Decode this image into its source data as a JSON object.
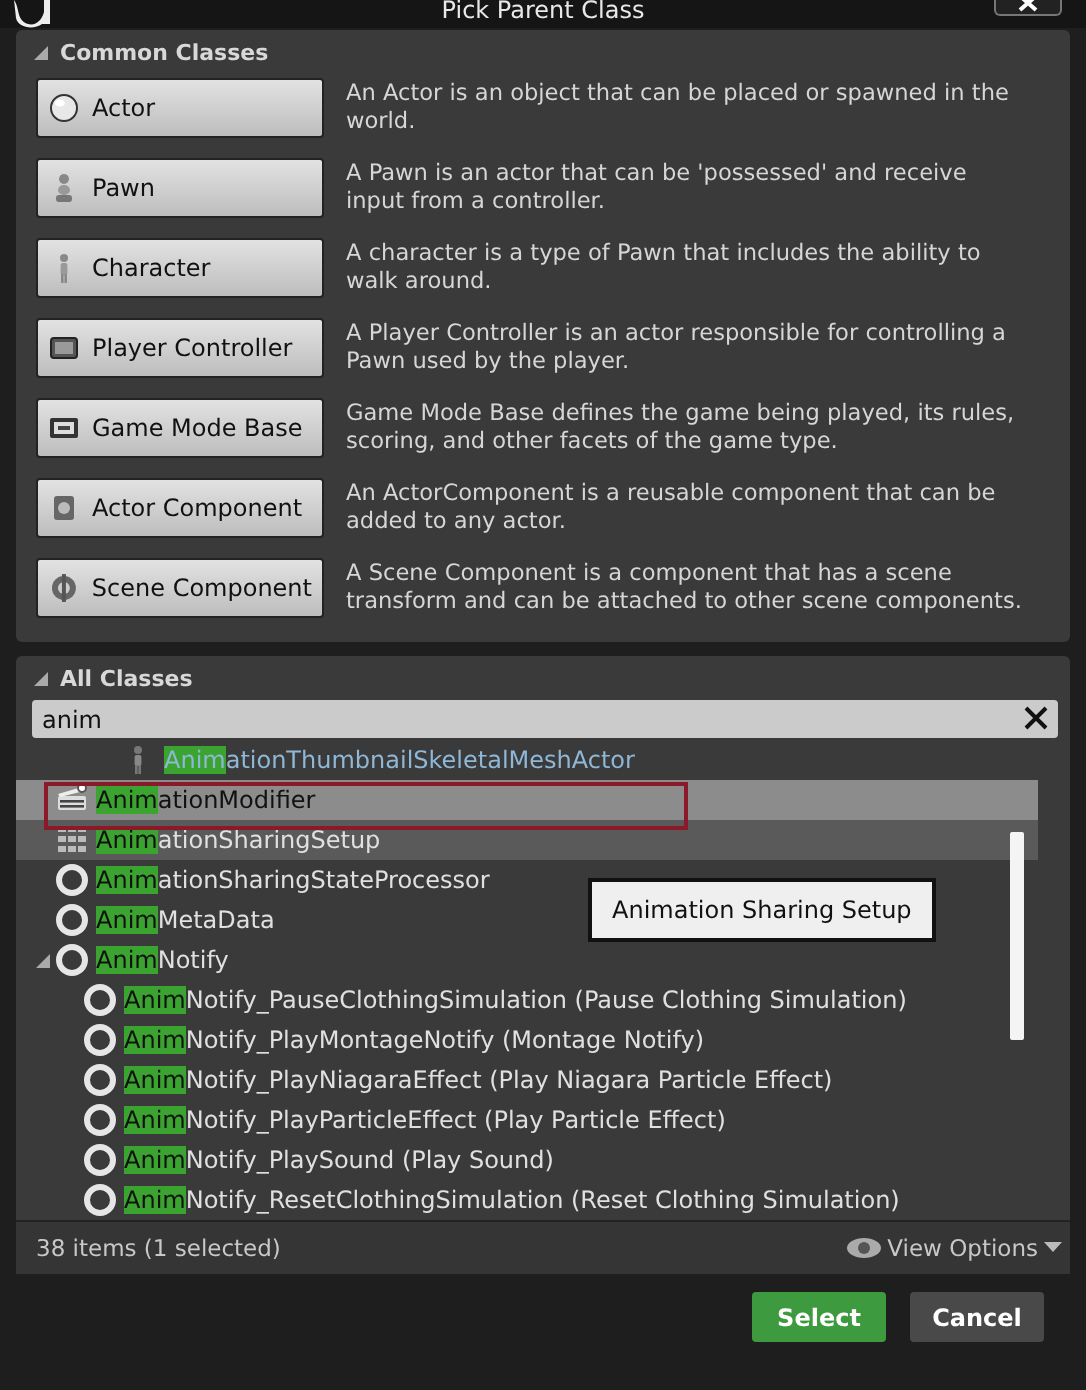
{
  "window": {
    "title": "Pick Parent Class"
  },
  "common_classes": {
    "title": "Common Classes",
    "expanded": true,
    "items": [
      {
        "kind": "actor",
        "label": "Actor",
        "description": "An Actor is an object that can be placed or spawned in the world."
      },
      {
        "kind": "pawn",
        "label": "Pawn",
        "description": "A Pawn is an actor that can be 'possessed' and receive input from a controller."
      },
      {
        "kind": "character",
        "label": "Character",
        "description": "A character is a type of Pawn that includes the ability to walk around."
      },
      {
        "kind": "controller",
        "label": "Player Controller",
        "description": "A Player Controller is an actor responsible for controlling a Pawn used by the player."
      },
      {
        "kind": "gamemode",
        "label": "Game Mode Base",
        "description": "Game Mode Base defines the game being played, its rules, scoring, and other facets of the game type."
      },
      {
        "kind": "component",
        "label": "Actor Component",
        "description": "An ActorComponent is a reusable component that can be added to any actor."
      },
      {
        "kind": "scene",
        "label": "Scene Component",
        "description": "A Scene Component is a component that has a scene transform and can be attached to other scene components."
      }
    ]
  },
  "all_classes": {
    "title": "All Classes",
    "expanded": true,
    "search": {
      "value": "anim"
    },
    "items": [
      {
        "kind": "blueprint",
        "match": "Anim",
        "rest": "ationThumbnailSkeletalMeshActor",
        "selected": false,
        "hovered": false
      },
      {
        "kind": "modifier",
        "match": "Anim",
        "rest": "ationModifier",
        "selected": true,
        "hovered": false
      },
      {
        "kind": "grid",
        "match": "Anim",
        "rest": "ationSharingSetup",
        "selected": false,
        "hovered": true
      },
      {
        "kind": "class",
        "match": "Anim",
        "rest": "ationSharingStateProcessor",
        "selected": false,
        "hovered": false
      },
      {
        "kind": "class",
        "match": "Anim",
        "rest": "MetaData",
        "selected": false,
        "hovered": false
      },
      {
        "kind": "class",
        "match": "Anim",
        "rest": "Notify",
        "selected": false,
        "hovered": false,
        "expanded": true,
        "children": [
          {
            "kind": "class",
            "match": "Anim",
            "rest": "Notify_PauseClothingSimulation (Pause Clothing Simulation)",
            "selected": false,
            "hovered": false
          },
          {
            "kind": "class",
            "match": "Anim",
            "rest": "Notify_PlayMontageNotify (Montage Notify)",
            "selected": false,
            "hovered": false
          },
          {
            "kind": "class",
            "match": "Anim",
            "rest": "Notify_PlayNiagaraEffect (Play Niagara Particle Effect)",
            "selected": false,
            "hovered": false
          },
          {
            "kind": "class",
            "match": "Anim",
            "rest": "Notify_PlayParticleEffect (Play Particle Effect)",
            "selected": false,
            "hovered": false
          },
          {
            "kind": "class",
            "match": "Anim",
            "rest": "Notify_PlaySound (Play Sound)",
            "selected": false,
            "hovered": false
          },
          {
            "kind": "class",
            "match": "Anim",
            "rest": "Notify_ResetClothingSimulation (Reset Clothing Simulation)",
            "selected": false,
            "hovered": false
          }
        ]
      }
    ],
    "tooltip": "Animation Sharing Setup",
    "status": "38 items (1 selected)",
    "view_options": "View Options"
  },
  "buttons": [
    {
      "kind": "primary",
      "label": "Select"
    },
    {
      "kind": "secondary",
      "label": "Cancel"
    }
  ]
}
